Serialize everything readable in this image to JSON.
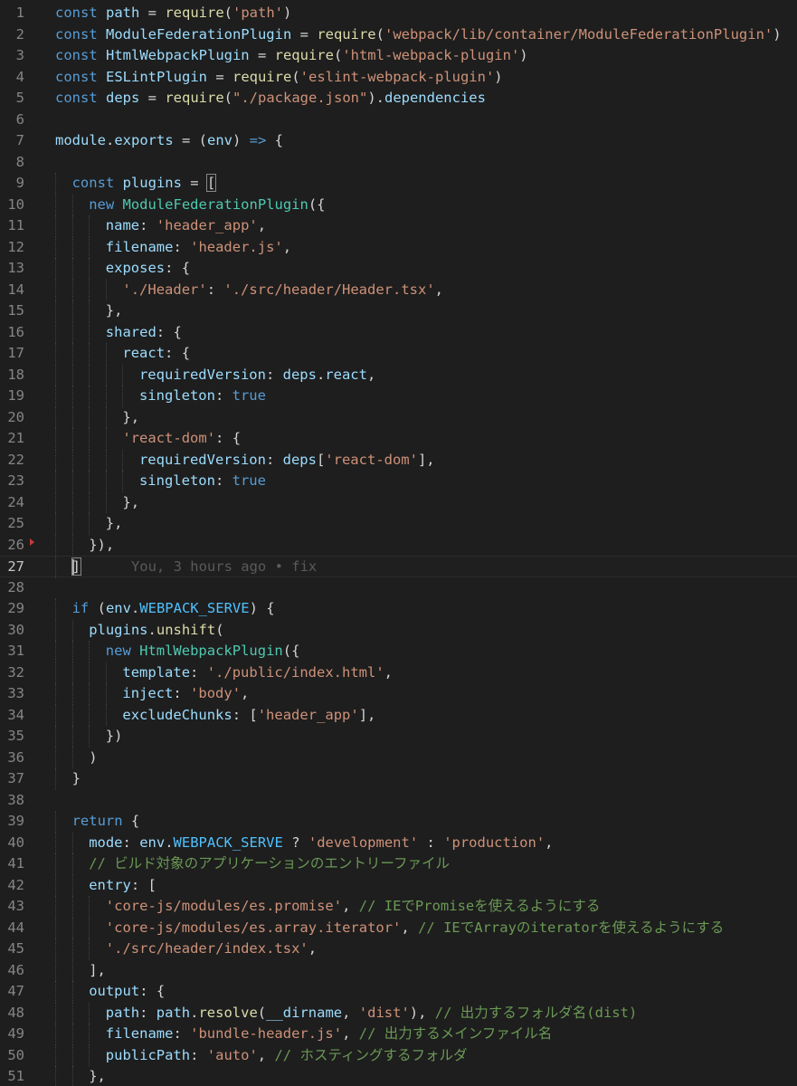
{
  "editor": {
    "current_line": 27,
    "blame": "You, 3 hours ago • fix",
    "lines": [
      {
        "n": 1,
        "indent": 0,
        "tokens": [
          [
            "k",
            "const "
          ],
          [
            "v",
            "path"
          ],
          [
            "p",
            " = "
          ],
          [
            "fn",
            "require"
          ],
          [
            "p",
            "("
          ],
          [
            "s",
            "'path'"
          ],
          [
            "p",
            ")"
          ]
        ]
      },
      {
        "n": 2,
        "indent": 0,
        "tokens": [
          [
            "k",
            "const "
          ],
          [
            "v",
            "ModuleFederationPlugin"
          ],
          [
            "p",
            " = "
          ],
          [
            "fn",
            "require"
          ],
          [
            "p",
            "("
          ],
          [
            "s",
            "'webpack/lib/container/ModuleFederationPlugin'"
          ],
          [
            "p",
            ")"
          ]
        ]
      },
      {
        "n": 3,
        "indent": 0,
        "tokens": [
          [
            "k",
            "const "
          ],
          [
            "v",
            "HtmlWebpackPlugin"
          ],
          [
            "p",
            " = "
          ],
          [
            "fn",
            "require"
          ],
          [
            "p",
            "("
          ],
          [
            "s",
            "'html-webpack-plugin'"
          ],
          [
            "p",
            ")"
          ]
        ]
      },
      {
        "n": 4,
        "indent": 0,
        "tokens": [
          [
            "k",
            "const "
          ],
          [
            "v",
            "ESLintPlugin"
          ],
          [
            "p",
            " = "
          ],
          [
            "fn",
            "require"
          ],
          [
            "p",
            "("
          ],
          [
            "s",
            "'eslint-webpack-plugin'"
          ],
          [
            "p",
            ")"
          ]
        ]
      },
      {
        "n": 5,
        "indent": 0,
        "tokens": [
          [
            "k",
            "const "
          ],
          [
            "v",
            "deps"
          ],
          [
            "p",
            " = "
          ],
          [
            "fn",
            "require"
          ],
          [
            "p",
            "("
          ],
          [
            "s",
            "\"./package.json\""
          ],
          [
            "p",
            ")."
          ],
          [
            "v",
            "dependencies"
          ]
        ]
      },
      {
        "n": 6,
        "indent": 0,
        "tokens": []
      },
      {
        "n": 7,
        "indent": 0,
        "tokens": [
          [
            "v",
            "module"
          ],
          [
            "p",
            "."
          ],
          [
            "v",
            "exports"
          ],
          [
            "p",
            " = ("
          ],
          [
            "v",
            "env"
          ],
          [
            "p",
            ") "
          ],
          [
            "k",
            "=>"
          ],
          [
            "p",
            " {"
          ]
        ]
      },
      {
        "n": 8,
        "indent": 0,
        "tokens": []
      },
      {
        "n": 9,
        "indent": 1,
        "tokens": [
          [
            "k",
            "const "
          ],
          [
            "v",
            "plugins"
          ],
          [
            "p",
            " = "
          ],
          [
            "p",
            "["
          ]
        ]
      },
      {
        "n": 10,
        "indent": 2,
        "tokens": [
          [
            "k",
            "new "
          ],
          [
            "ty",
            "ModuleFederationPlugin"
          ],
          [
            "p",
            "({"
          ]
        ]
      },
      {
        "n": 11,
        "indent": 3,
        "tokens": [
          [
            "v",
            "name"
          ],
          [
            "p",
            ": "
          ],
          [
            "s",
            "'header_app'"
          ],
          [
            "p",
            ","
          ]
        ]
      },
      {
        "n": 12,
        "indent": 3,
        "tokens": [
          [
            "v",
            "filename"
          ],
          [
            "p",
            ": "
          ],
          [
            "s",
            "'header.js'"
          ],
          [
            "p",
            ","
          ]
        ]
      },
      {
        "n": 13,
        "indent": 3,
        "tokens": [
          [
            "v",
            "exposes"
          ],
          [
            "p",
            ": {"
          ]
        ]
      },
      {
        "n": 14,
        "indent": 4,
        "tokens": [
          [
            "s",
            "'./Header'"
          ],
          [
            "p",
            ": "
          ],
          [
            "s",
            "'./src/header/Header.tsx'"
          ],
          [
            "p",
            ","
          ]
        ]
      },
      {
        "n": 15,
        "indent": 3,
        "tokens": [
          [
            "p",
            "},"
          ]
        ]
      },
      {
        "n": 16,
        "indent": 3,
        "tokens": [
          [
            "v",
            "shared"
          ],
          [
            "p",
            ": {"
          ]
        ]
      },
      {
        "n": 17,
        "indent": 4,
        "tokens": [
          [
            "v",
            "react"
          ],
          [
            "p",
            ": {"
          ]
        ]
      },
      {
        "n": 18,
        "indent": 5,
        "tokens": [
          [
            "v",
            "requiredVersion"
          ],
          [
            "p",
            ": "
          ],
          [
            "v",
            "deps"
          ],
          [
            "p",
            "."
          ],
          [
            "v",
            "react"
          ],
          [
            "p",
            ","
          ]
        ]
      },
      {
        "n": 19,
        "indent": 5,
        "tokens": [
          [
            "v",
            "singleton"
          ],
          [
            "p",
            ": "
          ],
          [
            "k",
            "true"
          ]
        ]
      },
      {
        "n": 20,
        "indent": 4,
        "tokens": [
          [
            "p",
            "},"
          ]
        ]
      },
      {
        "n": 21,
        "indent": 4,
        "tokens": [
          [
            "s",
            "'react-dom'"
          ],
          [
            "p",
            ": {"
          ]
        ]
      },
      {
        "n": 22,
        "indent": 5,
        "tokens": [
          [
            "v",
            "requiredVersion"
          ],
          [
            "p",
            ": "
          ],
          [
            "v",
            "deps"
          ],
          [
            "p",
            "["
          ],
          [
            "s",
            "'react-dom'"
          ],
          [
            "p",
            "],"
          ]
        ]
      },
      {
        "n": 23,
        "indent": 5,
        "tokens": [
          [
            "v",
            "singleton"
          ],
          [
            "p",
            ": "
          ],
          [
            "k",
            "true"
          ]
        ]
      },
      {
        "n": 24,
        "indent": 4,
        "tokens": [
          [
            "p",
            "},"
          ]
        ]
      },
      {
        "n": 25,
        "indent": 3,
        "tokens": [
          [
            "p",
            "},"
          ]
        ]
      },
      {
        "n": 26,
        "indent": 2,
        "tokens": [
          [
            "p",
            "}),"
          ]
        ]
      },
      {
        "n": 27,
        "indent": 1,
        "tokens": [
          [
            "p",
            "]"
          ]
        ]
      },
      {
        "n": 28,
        "indent": 0,
        "tokens": []
      },
      {
        "n": 29,
        "indent": 1,
        "tokens": [
          [
            "k",
            "if "
          ],
          [
            "p",
            "("
          ],
          [
            "v",
            "env"
          ],
          [
            "p",
            "."
          ],
          [
            "con",
            "WEBPACK_SERVE"
          ],
          [
            "p",
            ") {"
          ]
        ]
      },
      {
        "n": 30,
        "indent": 2,
        "tokens": [
          [
            "v",
            "plugins"
          ],
          [
            "p",
            "."
          ],
          [
            "fn",
            "unshift"
          ],
          [
            "p",
            "("
          ]
        ]
      },
      {
        "n": 31,
        "indent": 3,
        "tokens": [
          [
            "k",
            "new "
          ],
          [
            "ty",
            "HtmlWebpackPlugin"
          ],
          [
            "p",
            "({"
          ]
        ]
      },
      {
        "n": 32,
        "indent": 4,
        "tokens": [
          [
            "v",
            "template"
          ],
          [
            "p",
            ": "
          ],
          [
            "s",
            "'./public/index.html'"
          ],
          [
            "p",
            ","
          ]
        ]
      },
      {
        "n": 33,
        "indent": 4,
        "tokens": [
          [
            "v",
            "inject"
          ],
          [
            "p",
            ": "
          ],
          [
            "s",
            "'body'"
          ],
          [
            "p",
            ","
          ]
        ]
      },
      {
        "n": 34,
        "indent": 4,
        "tokens": [
          [
            "v",
            "excludeChunks"
          ],
          [
            "p",
            ": ["
          ],
          [
            "s",
            "'header_app'"
          ],
          [
            "p",
            "],"
          ]
        ]
      },
      {
        "n": 35,
        "indent": 3,
        "tokens": [
          [
            "p",
            "})"
          ]
        ]
      },
      {
        "n": 36,
        "indent": 2,
        "tokens": [
          [
            "p",
            ")"
          ]
        ]
      },
      {
        "n": 37,
        "indent": 1,
        "tokens": [
          [
            "p",
            "}"
          ]
        ]
      },
      {
        "n": 38,
        "indent": 0,
        "tokens": []
      },
      {
        "n": 39,
        "indent": 1,
        "tokens": [
          [
            "k",
            "return "
          ],
          [
            "p",
            "{"
          ]
        ]
      },
      {
        "n": 40,
        "indent": 2,
        "tokens": [
          [
            "v",
            "mode"
          ],
          [
            "p",
            ": "
          ],
          [
            "v",
            "env"
          ],
          [
            "p",
            "."
          ],
          [
            "con",
            "WEBPACK_SERVE"
          ],
          [
            "p",
            " ? "
          ],
          [
            "s",
            "'development'"
          ],
          [
            "p",
            " : "
          ],
          [
            "s",
            "'production'"
          ],
          [
            "p",
            ","
          ]
        ]
      },
      {
        "n": 41,
        "indent": 2,
        "tokens": [
          [
            "c",
            "// ビルド対象のアプリケーションのエントリーファイル"
          ]
        ]
      },
      {
        "n": 42,
        "indent": 2,
        "tokens": [
          [
            "v",
            "entry"
          ],
          [
            "p",
            ": ["
          ]
        ]
      },
      {
        "n": 43,
        "indent": 3,
        "tokens": [
          [
            "s",
            "'core-js/modules/es.promise'"
          ],
          [
            "p",
            ", "
          ],
          [
            "c",
            "// IEでPromiseを使えるようにする"
          ]
        ]
      },
      {
        "n": 44,
        "indent": 3,
        "tokens": [
          [
            "s",
            "'core-js/modules/es.array.iterator'"
          ],
          [
            "p",
            ", "
          ],
          [
            "c",
            "// IEでArrayのiteratorを使えるようにする"
          ]
        ]
      },
      {
        "n": 45,
        "indent": 3,
        "tokens": [
          [
            "s",
            "'./src/header/index.tsx'"
          ],
          [
            "p",
            ","
          ]
        ]
      },
      {
        "n": 46,
        "indent": 2,
        "tokens": [
          [
            "p",
            "],"
          ]
        ]
      },
      {
        "n": 47,
        "indent": 2,
        "tokens": [
          [
            "v",
            "output"
          ],
          [
            "p",
            ": {"
          ]
        ]
      },
      {
        "n": 48,
        "indent": 3,
        "tokens": [
          [
            "v",
            "path"
          ],
          [
            "p",
            ": "
          ],
          [
            "v",
            "path"
          ],
          [
            "p",
            "."
          ],
          [
            "fn",
            "resolve"
          ],
          [
            "p",
            "("
          ],
          [
            "v",
            "__dirname"
          ],
          [
            "p",
            ", "
          ],
          [
            "s",
            "'dist'"
          ],
          [
            "p",
            "), "
          ],
          [
            "c",
            "// 出力するフォルダ名(dist)"
          ]
        ]
      },
      {
        "n": 49,
        "indent": 3,
        "tokens": [
          [
            "v",
            "filename"
          ],
          [
            "p",
            ": "
          ],
          [
            "s",
            "'bundle-header.js'"
          ],
          [
            "p",
            ", "
          ],
          [
            "c",
            "// 出力するメインファイル名"
          ]
        ]
      },
      {
        "n": 50,
        "indent": 3,
        "tokens": [
          [
            "v",
            "publicPath"
          ],
          [
            "p",
            ": "
          ],
          [
            "s",
            "'auto'"
          ],
          [
            "p",
            ", "
          ],
          [
            "c",
            "// ホスティングするフォルダ"
          ]
        ]
      },
      {
        "n": 51,
        "indent": 2,
        "tokens": [
          [
            "p",
            "},"
          ]
        ]
      }
    ]
  }
}
